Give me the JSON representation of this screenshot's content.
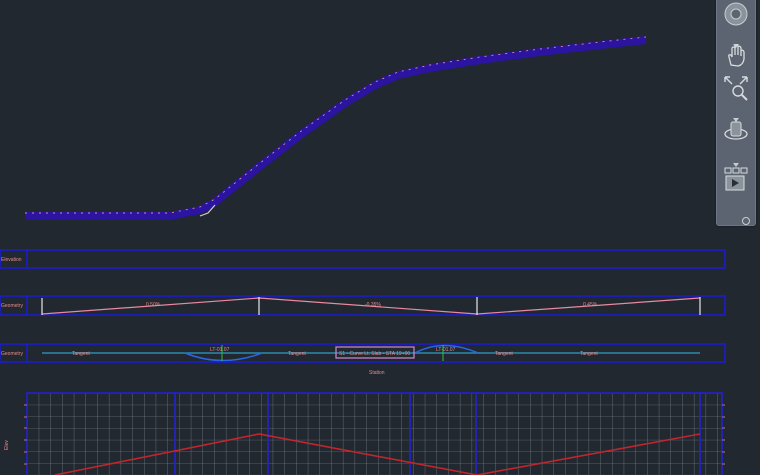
{
  "drawing": {
    "profile_band_label": "Elevation",
    "geometry_band_label": "Geometry",
    "alignment_band_label": "Geometry",
    "station_caption": "Station",
    "grid_axis_label": "Elev",
    "callout_text": "S1 - Curve Lt. Slab - STA 19+00",
    "curve_label_1": "LT-01.07",
    "curve_label_2": "LT-01.07",
    "segment_labels": [
      "Tangent",
      "Tangent",
      "Tangent",
      "Tangent"
    ],
    "geometry_slope_labels": [
      "0.50%",
      "-0.35%",
      "0.45%"
    ]
  },
  "colors": {
    "background": "#212830",
    "band_border": "#1a1ad8",
    "profile_fill": "#2a14a0",
    "profile_line": "#e08aa0",
    "grid_minor": "#8a929c",
    "grid_major": "#2222d0",
    "design_line": "#c0262e",
    "alignment_line": "#2a8ab0",
    "curve": "#2a66e0"
  },
  "navbar": {
    "buttons": [
      "steering-wheel-icon",
      "pan-hand-icon",
      "zoom-extents-icon",
      "orbit-icon",
      "showmotion-icon"
    ]
  }
}
